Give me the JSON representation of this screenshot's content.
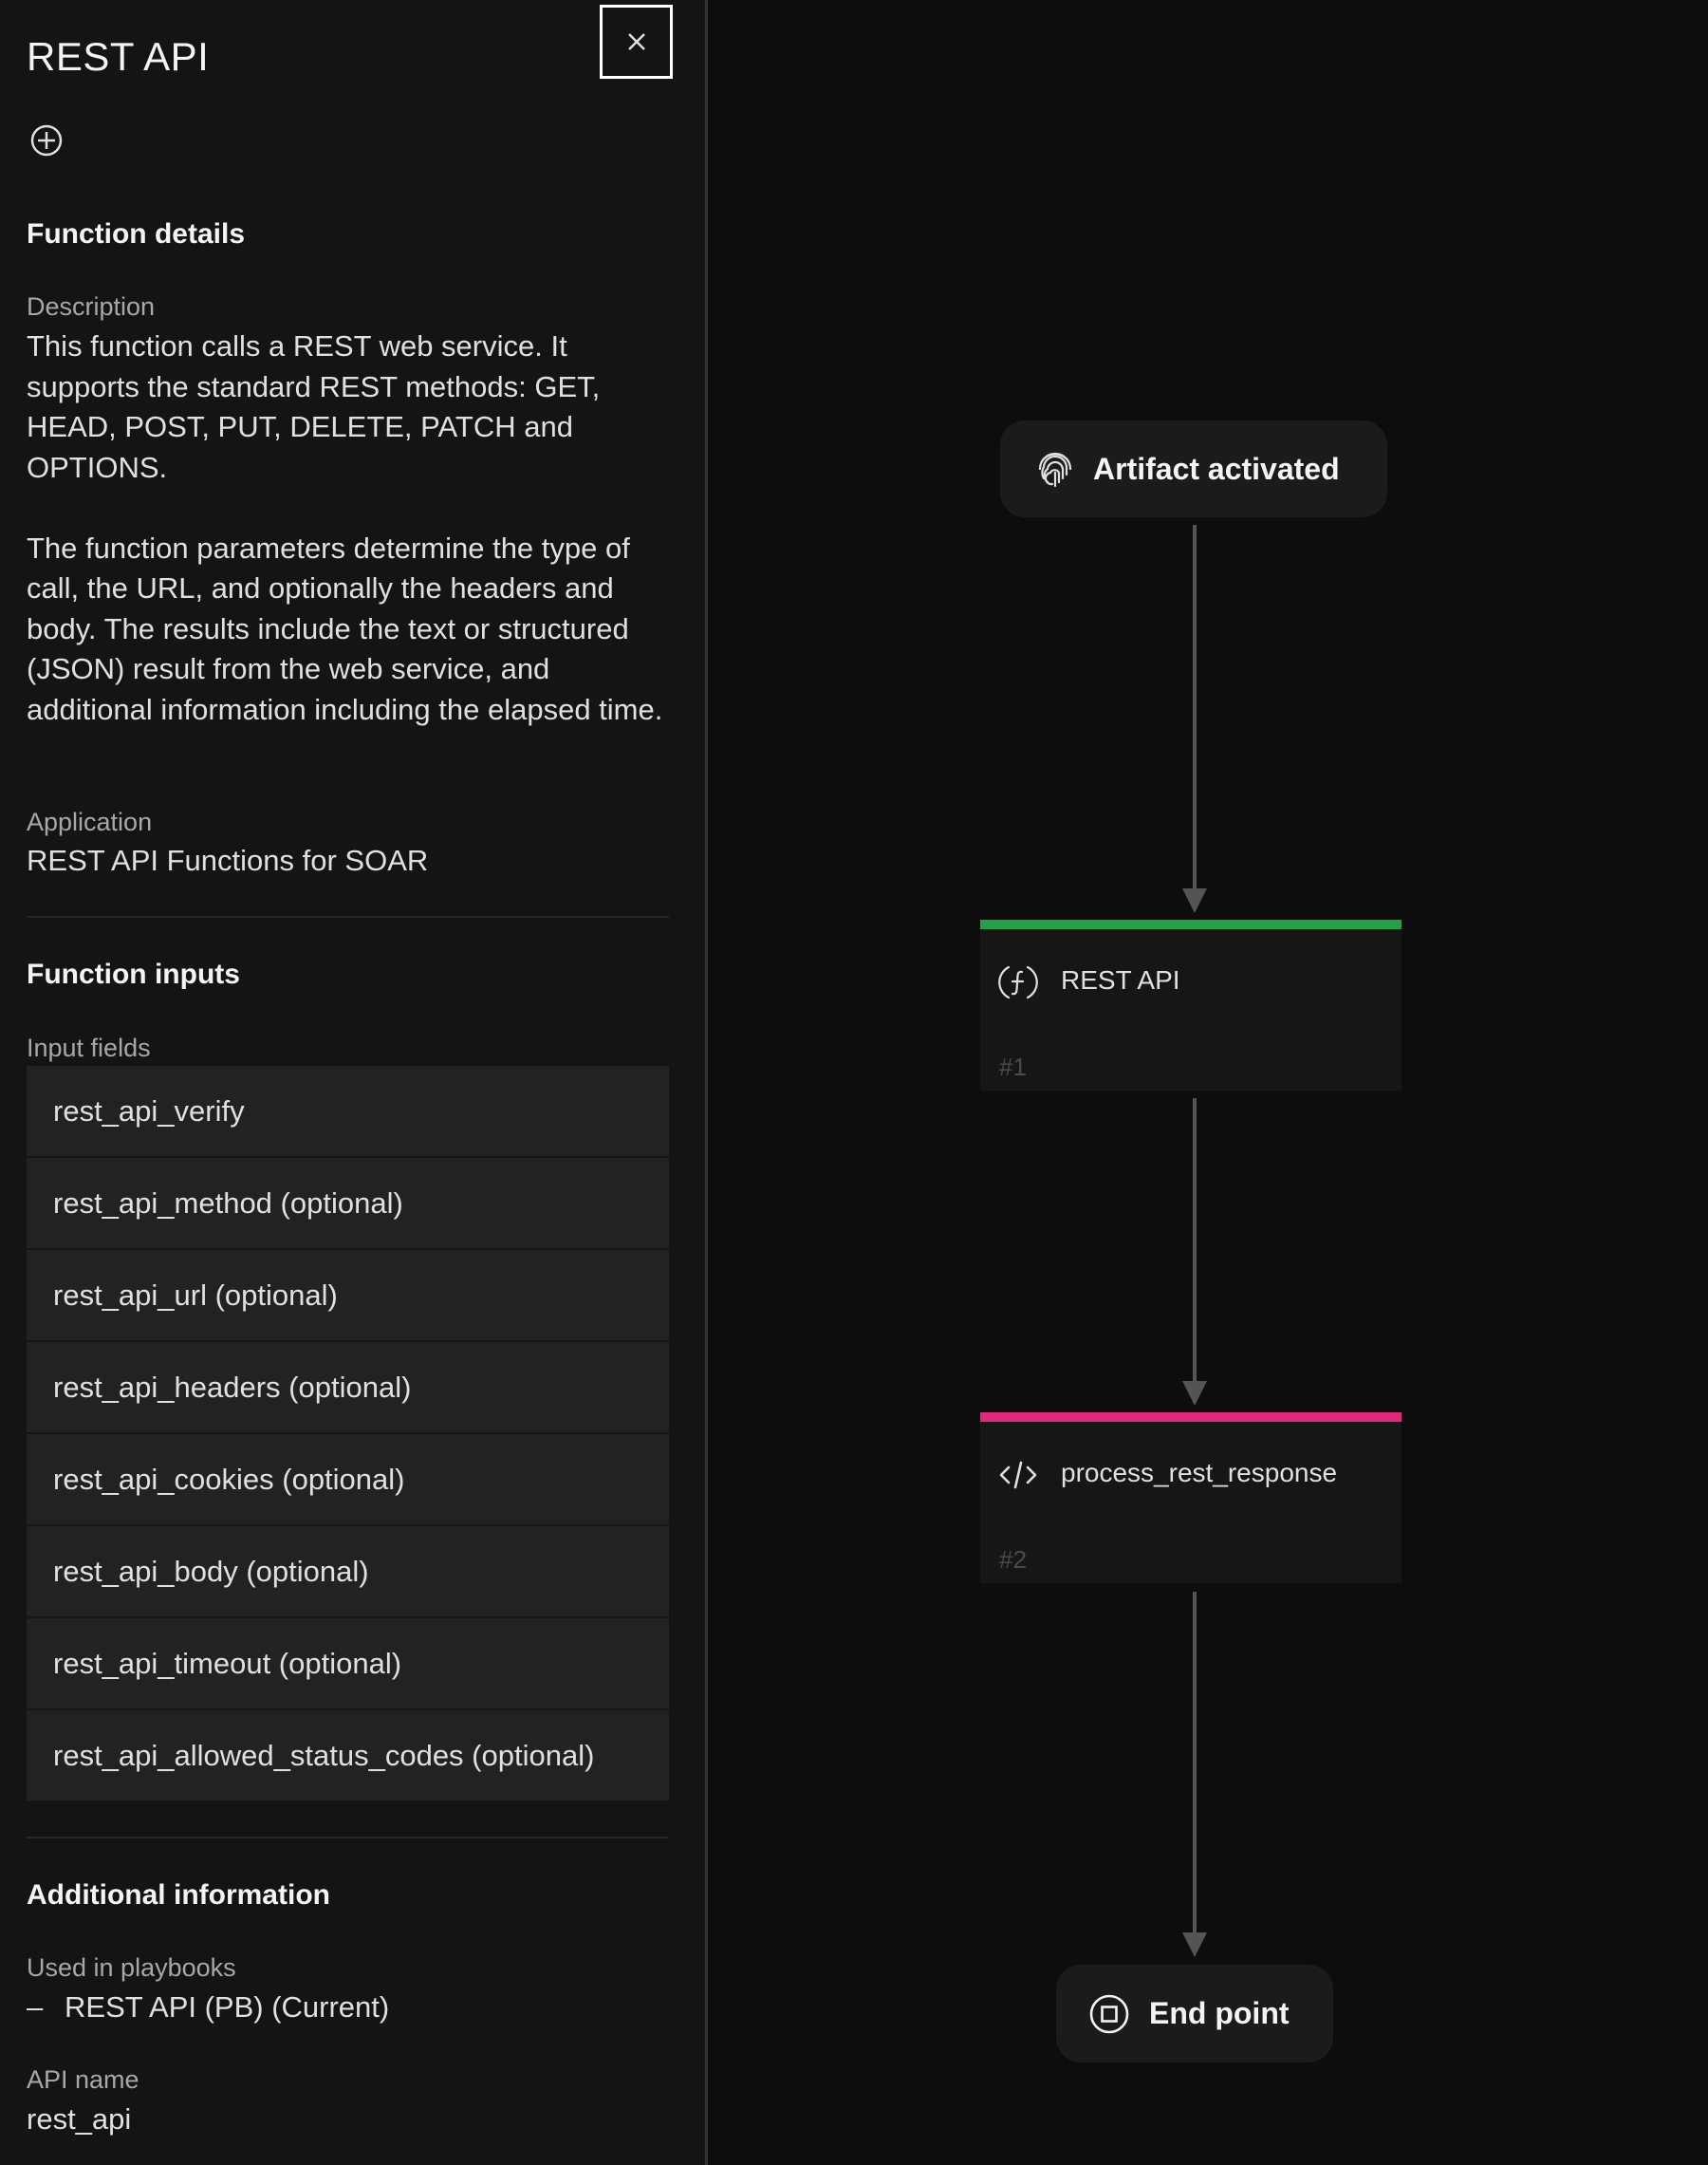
{
  "panel": {
    "title": "REST API",
    "close_label": "Close",
    "add_icon": "add-circle-icon",
    "function_details": {
      "heading": "Function details",
      "description_label": "Description",
      "description_paragraphs": [
        "This function calls a REST web service. It supports the standard REST methods: GET, HEAD, POST, PUT, DELETE, PATCH and OPTIONS.",
        "The function parameters determine the type of call, the URL, and optionally the headers and body. The results include the text or structured (JSON) result from the web service, and additional information including the elapsed time."
      ],
      "application_label": "Application",
      "application_value": "REST API Functions for SOAR"
    },
    "function_inputs": {
      "heading": "Function inputs",
      "input_fields_label": "Input fields",
      "fields": [
        "rest_api_verify",
        "rest_api_method (optional)",
        "rest_api_url (optional)",
        "rest_api_headers (optional)",
        "rest_api_cookies (optional)",
        "rest_api_body (optional)",
        "rest_api_timeout (optional)",
        "rest_api_allowed_status_codes (optional)"
      ]
    },
    "additional_information": {
      "heading": "Additional information",
      "used_in_playbooks_label": "Used in playbooks",
      "playbooks": [
        {
          "bullet": "–",
          "name": "REST API (PB) (Current)"
        }
      ],
      "api_name_label": "API name",
      "api_name_value": "rest_api"
    }
  },
  "workflow": {
    "nodes": [
      {
        "type": "start",
        "label": "Artifact activated",
        "icon": "fingerprint-icon"
      },
      {
        "type": "function",
        "label": "REST API",
        "number": "#1",
        "icon": "function-icon",
        "accent": "#24a148"
      },
      {
        "type": "script",
        "label": "process_rest_response",
        "number": "#2",
        "icon": "code-icon",
        "accent": "#e0287d"
      },
      {
        "type": "end",
        "label": "End point",
        "icon": "stop-circle-icon"
      }
    ]
  }
}
